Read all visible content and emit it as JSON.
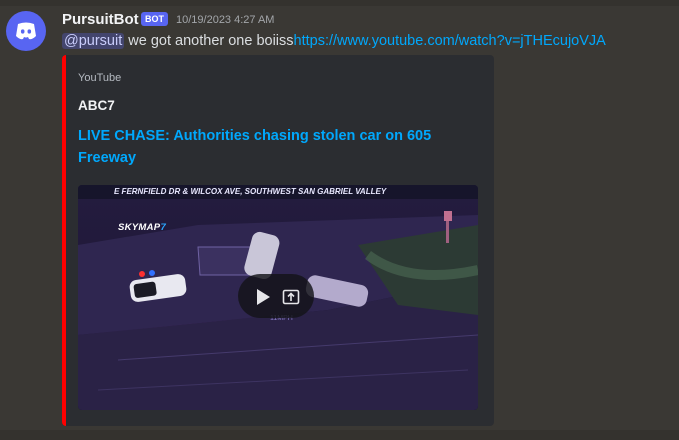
{
  "message": {
    "author": "PursuitBot",
    "bot_tag": "BOT",
    "timestamp": "10/19/2023 4:27 AM",
    "mention": "@pursuit",
    "text": " we got another one boiiss",
    "link": "https://www.youtube.com/watch?v=jTHEcujoVJA"
  },
  "embed": {
    "provider": "YouTube",
    "author": "ABC7",
    "title": "LIVE CHASE: Authorities chasing stolen car on 605 Freeway",
    "accent_color": "#ff0000",
    "video": {
      "caption": "E FERNFIELD DR & WILCOX AVE, SOUTHWEST SAN GABRIEL VALLEY",
      "logo_text": "SKYMAP",
      "logo_number": "7",
      "speed_text": "11MPH",
      "play_icon": "play-icon",
      "open_icon": "open-external-icon"
    }
  },
  "colors": {
    "background": "#3a3834",
    "embed_background": "#2b2d31",
    "link": "#00a8fc",
    "brand": "#5865f2"
  }
}
